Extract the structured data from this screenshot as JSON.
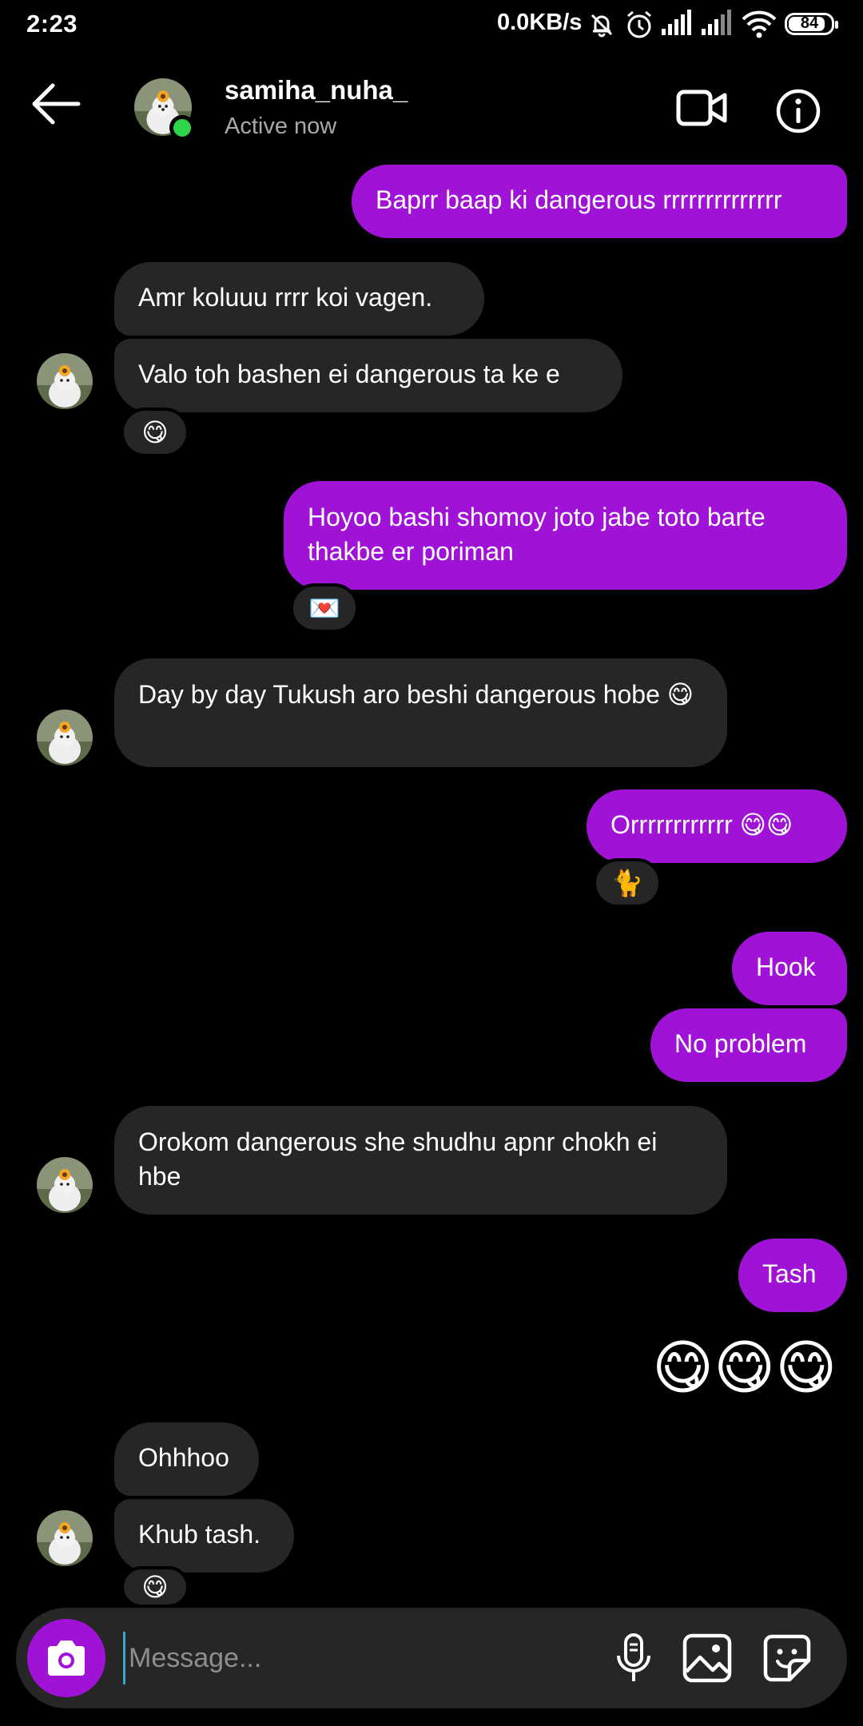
{
  "status_bar": {
    "time": "2:23",
    "net_speed": "0.0KB/s",
    "battery": "84"
  },
  "header": {
    "username": "samiha_nuha_",
    "status": "Active now"
  },
  "messages": {
    "m1": "Baprr baap ki dangerous rrrrrrrrrrrrrr",
    "m2": "Amr koluuu rrrr koi vagen.",
    "m3": "Valo toh bashen ei dangerous ta ke e",
    "m3_reaction": "😋",
    "m4": "Hoyoo bashi shomoy joto jabe toto barte thakbe er poriman",
    "m4_reaction": "💌",
    "m5": "Day by day Tukush aro beshi dangerous hobe 😋",
    "m6": "Orrrrrrrrrrrr 😋😋",
    "m6_reaction": "🐈",
    "m7": "Hook",
    "m8": "No problem",
    "m9": "Orokom dangerous she shudhu apnr chokh ei hbe",
    "m10": "Tash",
    "m11": "😋😋😋",
    "m12": "Ohhhoo",
    "m13": "Khub tash.",
    "m13_reaction": "😋"
  },
  "composer": {
    "placeholder": "Message..."
  },
  "colors": {
    "sent_bubble": "#a013d6",
    "received_bubble": "#262626",
    "online": "#2fd548"
  },
  "icons": [
    "back-arrow-icon",
    "video-call-icon",
    "info-icon",
    "camera-icon",
    "microphone-icon",
    "gallery-icon",
    "sticker-icon"
  ]
}
